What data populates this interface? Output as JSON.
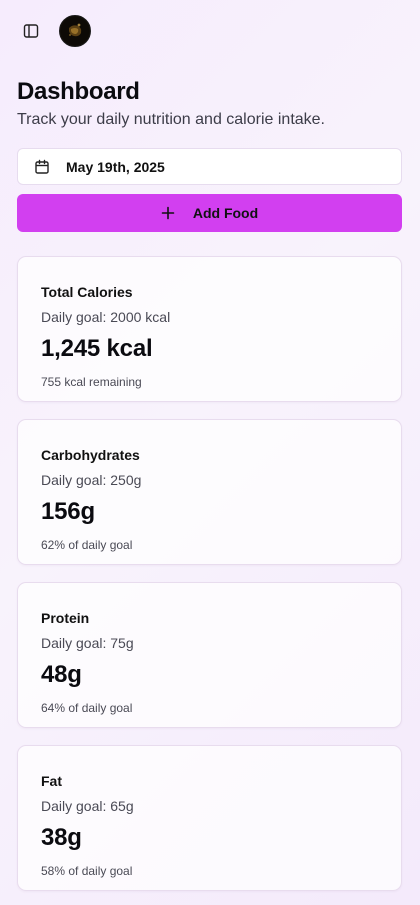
{
  "topbar": {
    "sidebar_toggle_icon": "sidebar-panel-icon",
    "avatar_icon": "user-avatar"
  },
  "header": {
    "title": "Dashboard",
    "subtitle": "Track your daily nutrition and calorie intake."
  },
  "date_picker": {
    "icon": "calendar-icon",
    "value": "May 19th, 2025"
  },
  "add_food": {
    "icon": "plus-icon",
    "label": "Add Food"
  },
  "colors": {
    "accent": "#d23ff0",
    "background": "#f6ecfd",
    "card": "#ffffff"
  },
  "cards": [
    {
      "title": "Total Calories",
      "goal": "Daily goal: 2000 kcal",
      "value": "1,245 kcal",
      "note": "755 kcal remaining"
    },
    {
      "title": "Carbohydrates",
      "goal": "Daily goal: 250g",
      "value": "156g",
      "note": "62% of daily goal"
    },
    {
      "title": "Protein",
      "goal": "Daily goal: 75g",
      "value": "48g",
      "note": "64% of daily goal"
    },
    {
      "title": "Fat",
      "goal": "Daily goal: 65g",
      "value": "38g",
      "note": "58% of daily goal"
    }
  ]
}
